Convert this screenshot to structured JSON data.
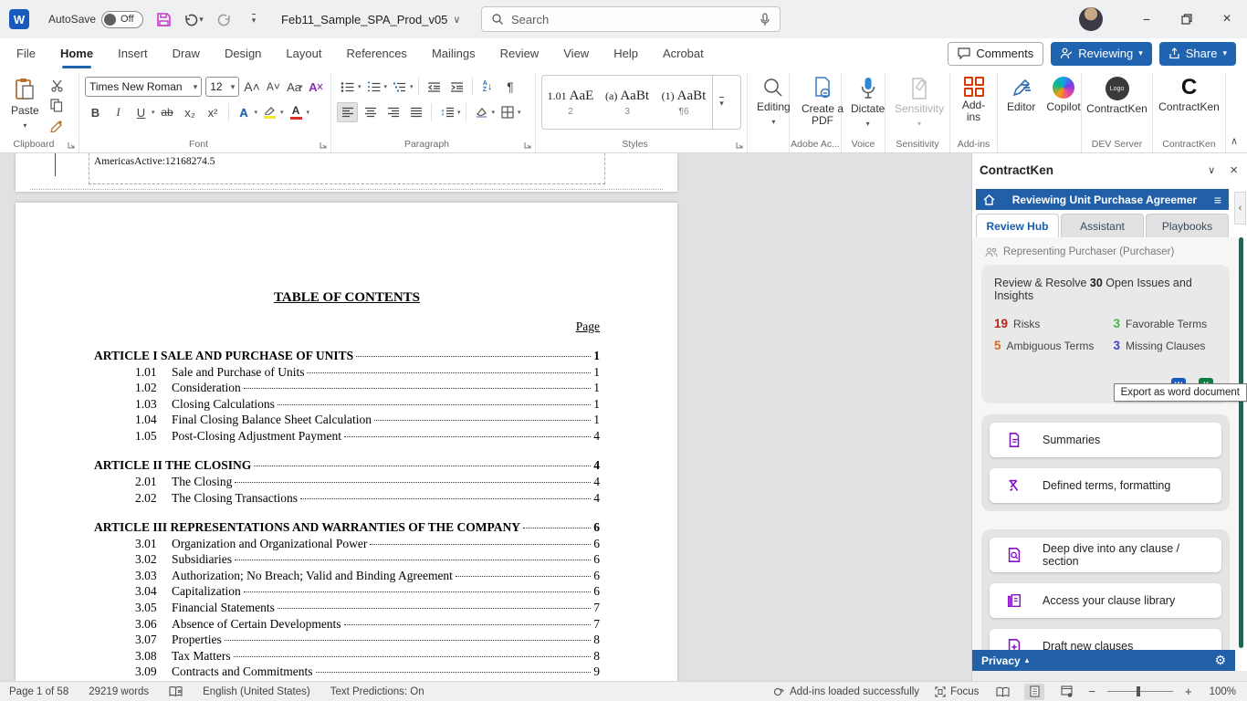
{
  "titlebar": {
    "autosave_label": "AutoSave",
    "autosave_state": "Off",
    "filename": "Feb11_Sample_SPA_Prod_v05",
    "search_placeholder": "Search"
  },
  "ribbon": {
    "tabs": [
      "File",
      "Home",
      "Insert",
      "Draw",
      "Design",
      "Layout",
      "References",
      "Mailings",
      "Review",
      "View",
      "Help",
      "Acrobat"
    ],
    "active_tab": "Home",
    "comments_label": "Comments",
    "reviewing_label": "Reviewing",
    "share_label": "Share",
    "clipboard": {
      "paste_label": "Paste",
      "group_label": "Clipboard"
    },
    "font": {
      "family": "Times New Roman",
      "size": "12",
      "group_label": "Font"
    },
    "paragraph": {
      "group_label": "Paragraph"
    },
    "styles": {
      "group_label": "Styles",
      "items": [
        {
          "prefix": "1.01",
          "sample": "AaE",
          "name": "2"
        },
        {
          "prefix": "(a)",
          "sample": "AaBt",
          "name": "3"
        },
        {
          "prefix": "(1)",
          "sample": "AaBt",
          "name": "¶6"
        }
      ]
    },
    "editing_label": "Editing",
    "create_pdf_label": "Create a PDF",
    "adobe_group_label": "Adobe Ac...",
    "dictate_label": "Dictate",
    "voice_group_label": "Voice",
    "sensitivity_label": "Sensitivity",
    "sensitivity_group_label": "Sensitivity",
    "addins_label": "Add-ins",
    "addins_group_label": "Add-ins",
    "editor_label": "Editor",
    "copilot_label": "Copilot",
    "contractken_dev_label": "ContractKen",
    "dev_group_label": "DEV Server",
    "contractken_label": "ContractKen",
    "contractken_group_label": "ContractKen",
    "logo_text": "Logo"
  },
  "document": {
    "prev_page_footer": "AmericasActive:12168274.5",
    "toc_title": "TABLE OF CONTENTS",
    "page_header": "Page",
    "sections": [
      {
        "heading": "ARTICLE I SALE AND PURCHASE OF UNITS",
        "page": "1",
        "entries": [
          {
            "num": "1.01",
            "title": "Sale and Purchase of Units",
            "page": "1"
          },
          {
            "num": "1.02",
            "title": "Consideration",
            "page": "1"
          },
          {
            "num": "1.03",
            "title": "Closing Calculations",
            "page": "1"
          },
          {
            "num": "1.04",
            "title": "Final Closing Balance Sheet Calculation",
            "page": "1"
          },
          {
            "num": "1.05",
            "title": "Post-Closing Adjustment Payment",
            "page": "4"
          }
        ]
      },
      {
        "heading": "ARTICLE II THE CLOSING",
        "page": "4",
        "entries": [
          {
            "num": "2.01",
            "title": "The Closing",
            "page": "4"
          },
          {
            "num": "2.02",
            "title": "The Closing Transactions",
            "page": "4"
          }
        ]
      },
      {
        "heading": "ARTICLE III REPRESENTATIONS AND WARRANTIES OF THE COMPANY",
        "page": "6",
        "entries": [
          {
            "num": "3.01",
            "title": "Organization and Organizational Power",
            "page": "6"
          },
          {
            "num": "3.02",
            "title": "Subsidiaries",
            "page": "6"
          },
          {
            "num": "3.03",
            "title": "Authorization; No Breach; Valid and Binding Agreement",
            "page": "6"
          },
          {
            "num": "3.04",
            "title": "Capitalization",
            "page": "6"
          },
          {
            "num": "3.05",
            "title": "Financial Statements",
            "page": "7"
          },
          {
            "num": "3.06",
            "title": "Absence of Certain Developments",
            "page": "7"
          },
          {
            "num": "3.07",
            "title": "Properties",
            "page": "8"
          },
          {
            "num": "3.08",
            "title": "Tax Matters",
            "page": "8"
          },
          {
            "num": "3.09",
            "title": "Contracts and Commitments",
            "page": "9"
          }
        ]
      }
    ]
  },
  "panel": {
    "title": "ContractKen",
    "header": "Reviewing Unit Purchase Agreemer",
    "tabs": [
      "Review Hub",
      "Assistant",
      "Playbooks"
    ],
    "active_tab": "Review Hub",
    "representing": "Representing Purchaser (Purchaser)",
    "summary": {
      "prefix": "Review & Resolve ",
      "count": "30",
      "suffix": " Open Issues and Insights"
    },
    "stats": [
      {
        "value": "19",
        "label": "Risks",
        "color": "#b3251d"
      },
      {
        "value": "3",
        "label": "Favorable Terms",
        "color": "#43b83f"
      },
      {
        "value": "5",
        "label": "Ambiguous Terms",
        "color": "#d2691e"
      },
      {
        "value": "3",
        "label": "Missing Clauses",
        "color": "#4343c8"
      }
    ],
    "tooltip": "Export as word document",
    "action_groups": [
      {
        "buttons": [
          {
            "icon": "document",
            "label": "Summaries"
          },
          {
            "icon": "defined-terms",
            "label": "Defined terms, formatting"
          }
        ]
      },
      {
        "buttons": [
          {
            "icon": "doc-search",
            "label": "Deep dive into any clause / section"
          },
          {
            "icon": "library",
            "label": "Access your clause library"
          },
          {
            "icon": "doc-add",
            "label": "Draft new clauses"
          }
        ]
      }
    ],
    "privacy_label": "Privacy"
  },
  "statusbar": {
    "page": "Page 1 of 58",
    "words": "29219 words",
    "language": "English (United States)",
    "predictions": "Text Predictions: On",
    "addins_status": "Add-ins loaded successfully",
    "focus": "Focus",
    "zoom": "100%"
  }
}
